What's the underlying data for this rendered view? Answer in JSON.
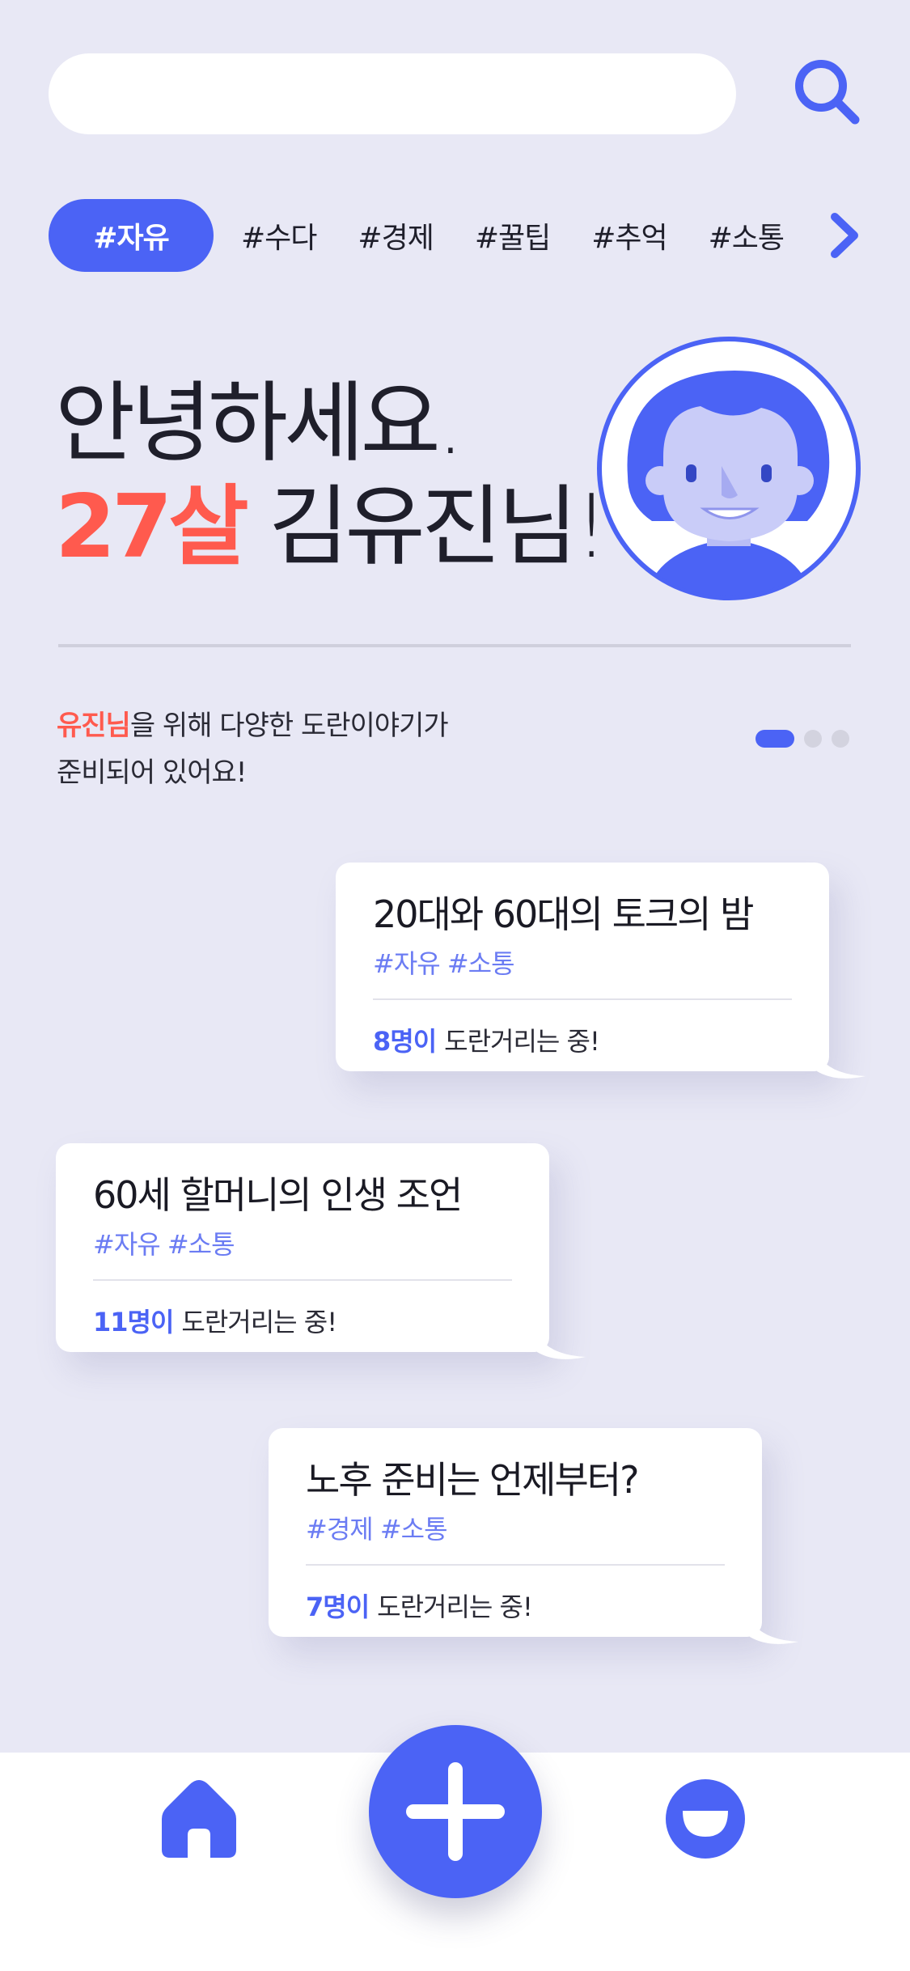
{
  "search": {
    "placeholder": "",
    "value": ""
  },
  "tags": [
    {
      "label": "#자유",
      "active": true
    },
    {
      "label": "#수다",
      "active": false
    },
    {
      "label": "#경제",
      "active": false
    },
    {
      "label": "#꿀팁",
      "active": false
    },
    {
      "label": "#추억",
      "active": false
    },
    {
      "label": "#소통",
      "active": false
    }
  ],
  "greeting": {
    "line1": "안녕하세요.",
    "age": "27살",
    "name": "김유진님!"
  },
  "intro": {
    "name": "유진님",
    "line1_rest": "을 위해 다양한 도란이야기가",
    "line2": "준비되어 있어요!"
  },
  "carousel": {
    "total": 3,
    "active": 1
  },
  "cards": [
    {
      "title": "20대와 60대의 토크의 밤",
      "tags": "#자유 #소통",
      "count": "8명이",
      "status": "도란거리는 중!"
    },
    {
      "title": "60세 할머니의 인생 조언",
      "tags": "#자유 #소통",
      "count": "11명이",
      "status": "도란거리는 중!"
    },
    {
      "title": "노후 준비는 언제부터?",
      "tags": "#경제 #소통",
      "count": "7명이",
      "status": "도란거리는 중!"
    }
  ],
  "icons": {
    "search": "search-icon",
    "next": "chevron-right-icon",
    "home": "home-icon",
    "add": "plus-icon",
    "profile": "profile-icon"
  },
  "colors": {
    "background": "#e8e8f5",
    "accent": "#4b63f5",
    "highlight": "#ff5a4e",
    "tag_text": "#6b7cf3",
    "white": "#ffffff"
  }
}
